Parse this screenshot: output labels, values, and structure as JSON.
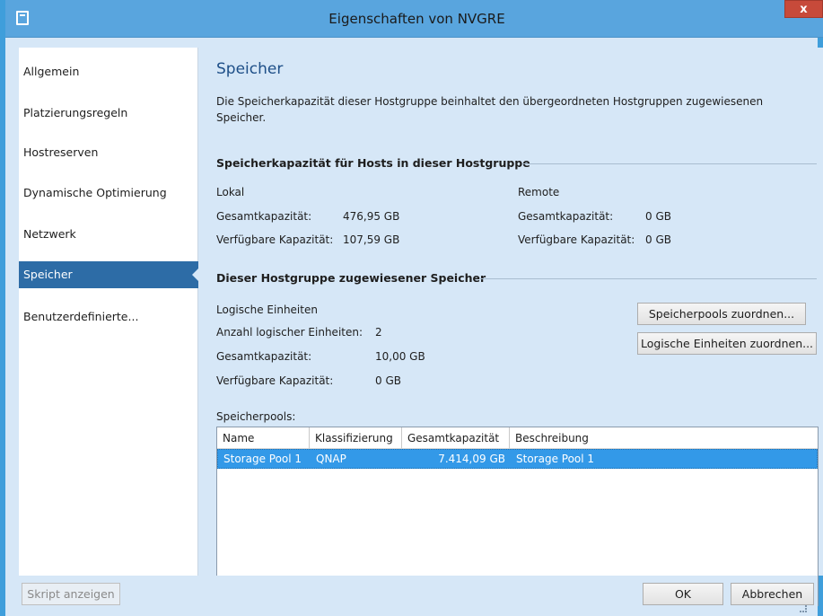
{
  "window": {
    "title": "Eigenschaften von NVGRE",
    "close_label": "x"
  },
  "nav": {
    "items": [
      {
        "label": "Allgemein"
      },
      {
        "label": "Platzierungsregeln"
      },
      {
        "label": "Hostreserven"
      },
      {
        "label": "Dynamische Optimierung"
      },
      {
        "label": "Netzwerk"
      },
      {
        "label": "Speicher"
      },
      {
        "label": "Benutzerdefinierte..."
      }
    ],
    "active": "Speicher"
  },
  "content": {
    "heading": "Speicher",
    "description_line1": "Die Speicherkapazität dieser Hostgruppe beinhaltet den übergeordneten Hostgruppen zugewiesenen",
    "description_line2": "Speicher.",
    "capacity_section": {
      "title": "Speicherkapazität für Hosts in dieser Hostgruppe",
      "local": {
        "label": "Lokal",
        "total_label": "Gesamtkapazität:",
        "total_value": "476,95 GB",
        "available_label": "Verfügbare Kapazität:",
        "available_value": "107,59 GB"
      },
      "remote": {
        "label": "Remote",
        "total_label": "Gesamtkapazität:",
        "total_value": "0 GB",
        "available_label": "Verfügbare Kapazität:",
        "available_value": "0 GB"
      }
    },
    "assigned_section": {
      "title": "Dieser Hostgruppe zugewiesener Speicher",
      "logical_units_label": "Logische Einheiten",
      "count_label": "Anzahl logischer Einheiten:",
      "count_value": "2",
      "total_label": "Gesamtkapazität:",
      "total_value": "10,00 GB",
      "available_label": "Verfügbare Kapazität:",
      "available_value": "0 GB",
      "assign_pools_button": "Speicherpools zuordnen...",
      "assign_units_button": "Logische Einheiten zuordnen..."
    },
    "pools": {
      "label": "Speicherpools:",
      "columns": [
        "Name",
        "Klassifizierung",
        "Gesamtkapazität",
        "Beschreibung"
      ],
      "rows": [
        {
          "name": "Storage Pool 1",
          "classification": "QNAP",
          "capacity": "7.414,09 GB",
          "description": "Storage Pool 1"
        }
      ]
    }
  },
  "footer": {
    "script_button": "Skript anzeigen",
    "ok_button": "OK",
    "cancel_button": "Abbrechen"
  },
  "colors": {
    "titlebar": "#59a5de",
    "nav_active": "#2d6ca6",
    "selection": "#3399e8",
    "heading": "#1e4f88"
  }
}
